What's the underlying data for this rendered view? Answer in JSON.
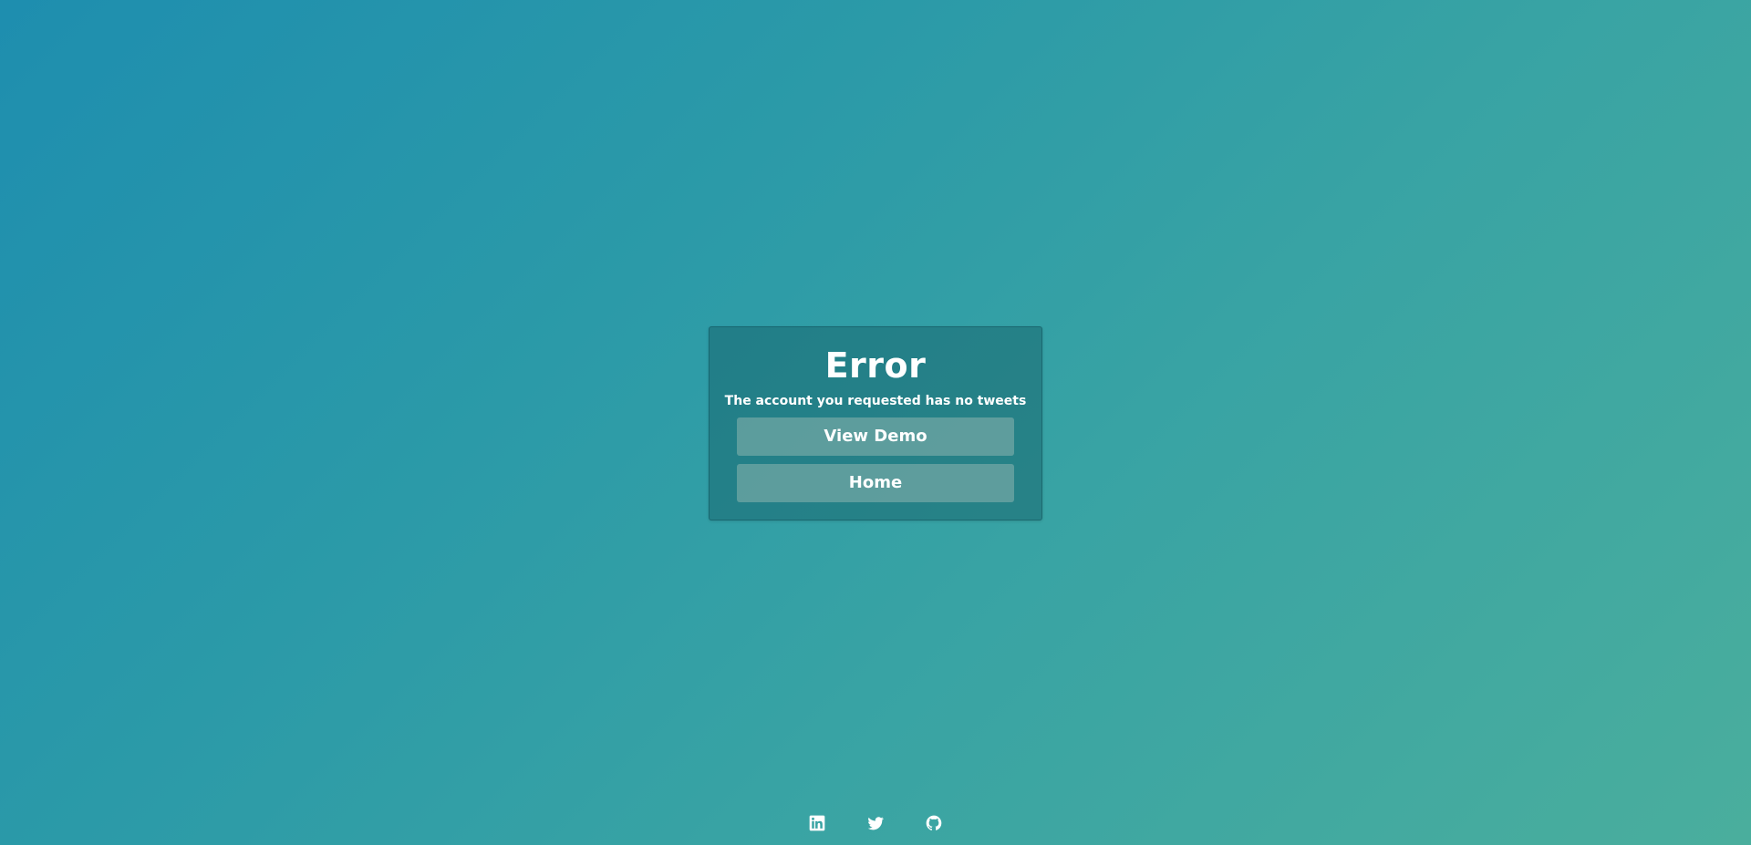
{
  "error_card": {
    "title": "Error",
    "message": "The account you requested has no tweets",
    "view_demo_label": "View Demo",
    "home_label": "Home"
  },
  "footer": {
    "links": [
      {
        "icon": "linkedin-icon"
      },
      {
        "icon": "twitter-icon"
      },
      {
        "icon": "github-icon"
      }
    ]
  },
  "colors": {
    "gradient_start": "#1e8eaf",
    "gradient_end": "#4aae9d",
    "text": "#ffffff"
  }
}
